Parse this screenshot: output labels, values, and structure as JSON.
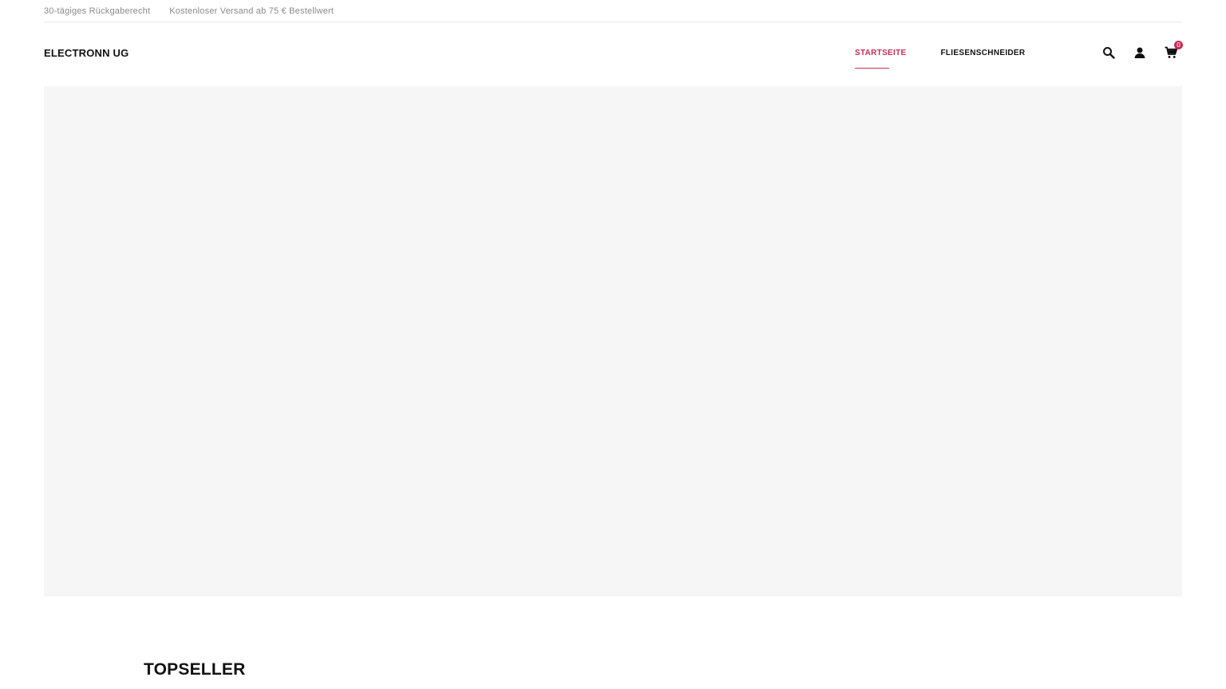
{
  "topbar": {
    "return_policy": "30-tägiges Rückgaberecht",
    "shipping": "Kostenloser Versand ab 75 € Bestellwert"
  },
  "header": {
    "brand": "ELECTRONN UG",
    "nav": [
      {
        "label": "STARTSEITE",
        "active": true
      },
      {
        "label": "FLIESENSCHNEIDER",
        "active": false
      }
    ],
    "icons": [
      "search-icon",
      "account-icon",
      "cart-icon"
    ],
    "cart_count": "0"
  },
  "colors": {
    "accent": "#c42d55",
    "hero_background": "#f6f6f6",
    "text": "#111111",
    "muted_text": "#8a8a8a"
  },
  "main": {
    "section_title": "TOPSELLER"
  }
}
